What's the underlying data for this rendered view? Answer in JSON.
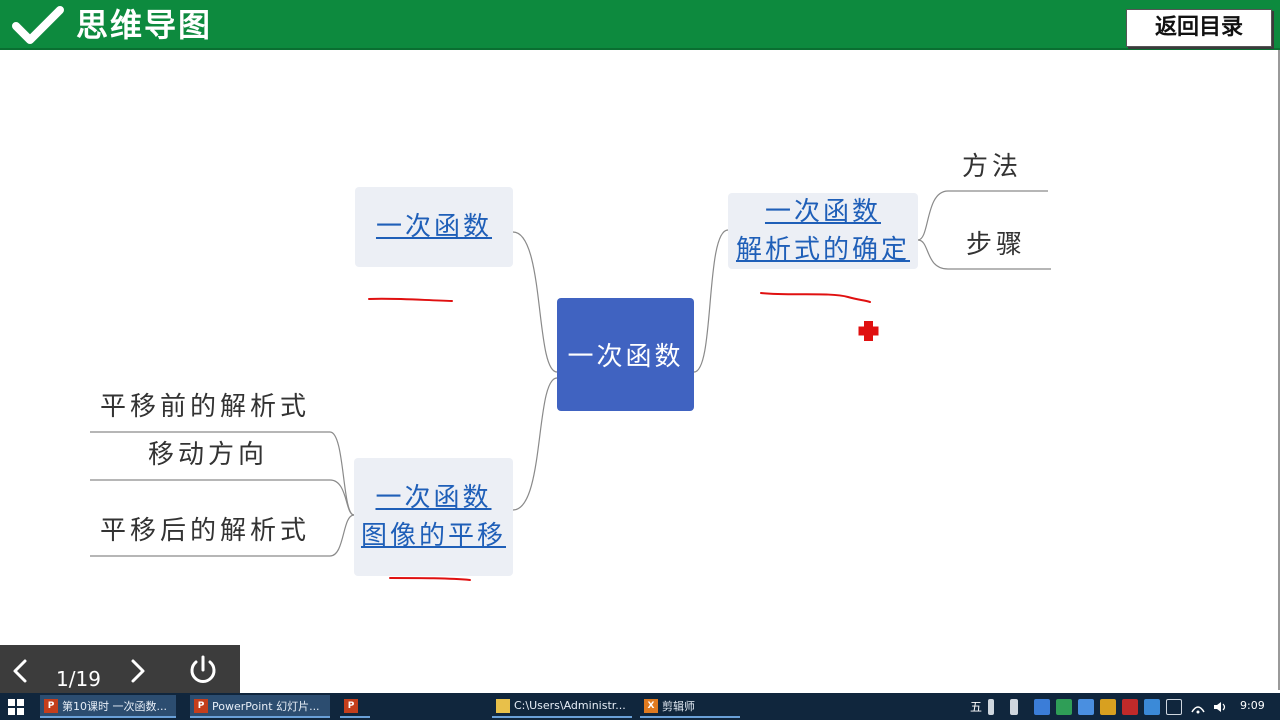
{
  "header": {
    "title": "思维导图",
    "back_label": "返回目录"
  },
  "mindmap": {
    "center": "一次函数",
    "left_top": {
      "label": "一次函数"
    },
    "left_bottom": {
      "line1": "一次函数",
      "line2": "图像的平移"
    },
    "right_top": {
      "line1": "一次函数",
      "line2": "解析式的确定"
    },
    "right_leaves": [
      "方法",
      "步骤"
    ],
    "left_leaves": [
      "平移前的解析式",
      "移动方向",
      "平移后的解析式"
    ]
  },
  "slide_controls": {
    "page": "1/19"
  },
  "taskbar": {
    "tasks": [
      {
        "label": "第10课时  一次函数...",
        "icon": "P"
      },
      {
        "label": "PowerPoint 幻灯片...",
        "icon": "P"
      },
      {
        "label": "",
        "icon": "P"
      },
      {
        "label": "C:\\Users\\Administr...",
        "icon": ""
      },
      {
        "label": "剪辑师",
        "icon": "X"
      }
    ],
    "ime": "五",
    "time": "9:09"
  },
  "colors": {
    "header_green": "#0d8a3e",
    "center_blue": "#4063c1",
    "link_blue": "#1f5fb8",
    "annotation_red": "#e01010"
  }
}
